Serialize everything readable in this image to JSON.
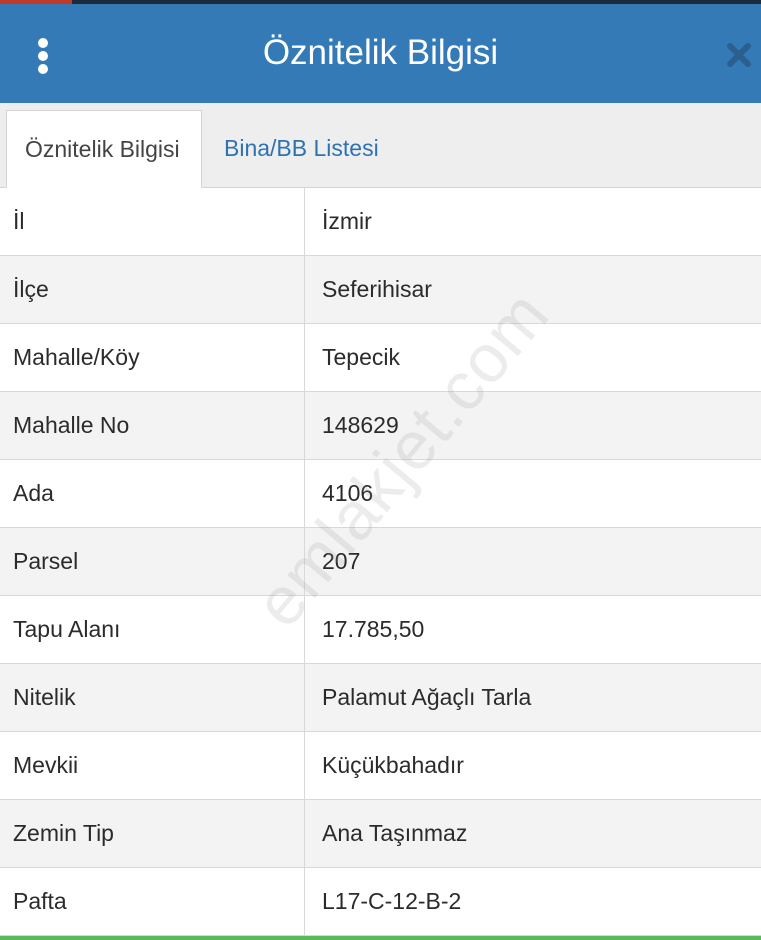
{
  "header": {
    "title": "Öznitelik Bilgisi"
  },
  "tabs": [
    {
      "label": "Öznitelik Bilgisi",
      "active": true
    },
    {
      "label": "Bina/BB Listesi",
      "active": false
    }
  ],
  "rows": [
    {
      "label": "İl",
      "value": "İzmir"
    },
    {
      "label": "İlçe",
      "value": "Seferihisar"
    },
    {
      "label": "Mahalle/Köy",
      "value": "Tepecik"
    },
    {
      "label": "Mahalle No",
      "value": "148629"
    },
    {
      "label": "Ada",
      "value": "4106"
    },
    {
      "label": "Parsel",
      "value": "207"
    },
    {
      "label": "Tapu Alanı",
      "value": "17.785,50"
    },
    {
      "label": "Nitelik",
      "value": "Palamut Ağaçlı Tarla"
    },
    {
      "label": "Mevkii",
      "value": "Küçükbahadır"
    },
    {
      "label": "Zemin Tip",
      "value": "Ana Taşınmaz"
    },
    {
      "label": "Pafta",
      "value": "L17-C-12-B-2"
    }
  ],
  "watermark": "emlakjet.com",
  "icons": {
    "menu": "more-vertical-icon",
    "close": "close-icon"
  },
  "colors": {
    "header_bg": "#337ab7",
    "tab_link": "#2e72b3",
    "bottom_bar": "#5cb85c"
  }
}
